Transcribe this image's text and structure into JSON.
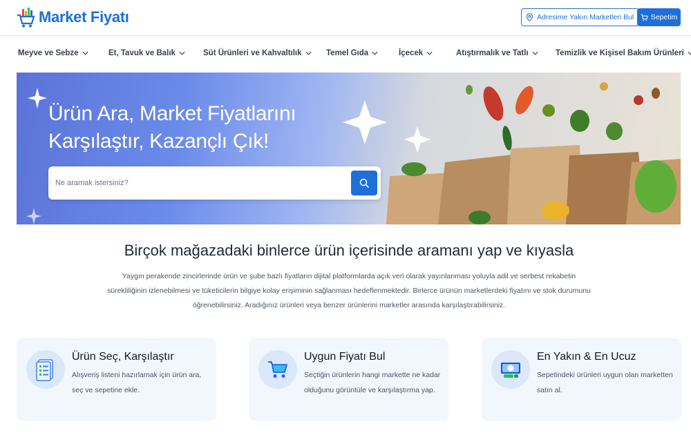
{
  "brand": {
    "name": "Market Fiyatı",
    "color": "#1e6fd9"
  },
  "header": {
    "address_button": "Adresime Yakın Marketleri Bul",
    "cart_button": "Sepetim"
  },
  "nav": {
    "items": [
      {
        "label": "Meyve ve Sebze"
      },
      {
        "label": "Et, Tavuk ve Balık"
      },
      {
        "label": "Süt Ürünleri ve Kahvaltılık"
      },
      {
        "label": "Temel Gıda"
      },
      {
        "label": "İçecek"
      },
      {
        "label": "Atıştırmalık ve Tatlı"
      },
      {
        "label": "Temizlik ve Kişisel Bakım Ürünleri"
      }
    ]
  },
  "hero": {
    "title_line1": "Ürün Ara, Market Fiyatlarını",
    "title_line2": "Karşılaştır, Kazançlı Çık!",
    "search_placeholder": "Ne aramak istersiniz?"
  },
  "intro": {
    "title": "Birçok mağazadaki binlerce ürün içerisinde aramanı yap ve kıyasla",
    "line1": "Yaygın perakende zincirlerinde ürün ve şube bazlı fiyatların dijital platformlarda açık veri olarak yayınlanması yoluyla adil ve serbest rekabetin",
    "line2": "sürekliliğinin izlenebilmesi ve tüketicilerin bilgiye kolay erişiminin sağlanması hedeflenmektedir. Birlerce ürünün marketlerdeki fiyatını ve stok durumunu",
    "line3": "öğrenebilirsiniz. Aradığınız ürünleri veya benzer ürünlerini marketler arasında karşılaştırabilirsiniz."
  },
  "features": [
    {
      "title": "Ürün Seç, Karşılaştır",
      "text": "Alışveriş listeni hazırlamak için ürün ara, seç ve sepetine ekle.",
      "icon": "checklist-icon"
    },
    {
      "title": "Uygun Fiyatı Bul",
      "text": "Seçtiğin ürünlerin hangi markette ne kadar olduğunu görüntüle ve karşılaştırma yap.",
      "icon": "cart-icon"
    },
    {
      "title": "En Yakın & En Ucuz",
      "text": "Sepetindeki ürünleri uygun olan marketten satın al.",
      "icon": "money-icon"
    }
  ]
}
